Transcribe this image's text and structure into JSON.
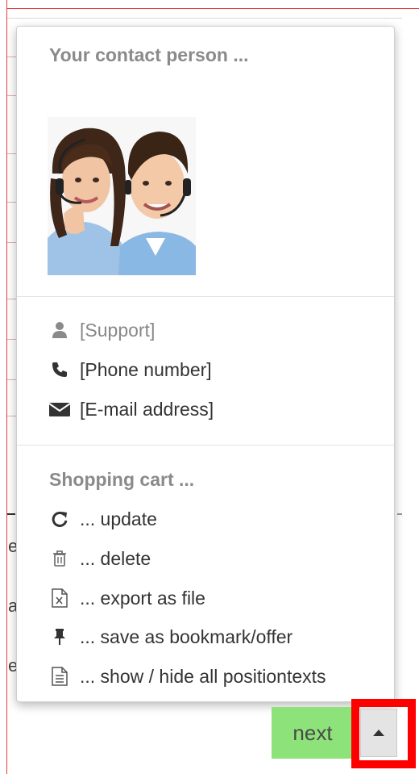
{
  "contact": {
    "title": "Your contact person ...",
    "photo_icon": "support-team-photo",
    "items": [
      {
        "icon": "user-icon",
        "label": "[Support]"
      },
      {
        "icon": "phone-icon",
        "label": "[Phone number]"
      },
      {
        "icon": "envelope-icon",
        "label": "[E-mail address]"
      }
    ]
  },
  "cart": {
    "title": "Shopping cart ...",
    "actions": [
      {
        "icon": "refresh-icon",
        "label": "... update"
      },
      {
        "icon": "trash-icon",
        "label": "... delete"
      },
      {
        "icon": "excel-file-icon",
        "label": "... export as file"
      },
      {
        "icon": "pin-icon",
        "label": "... save as bookmark/offer"
      },
      {
        "icon": "document-icon",
        "label": "... show / hide all positiontexts"
      }
    ]
  },
  "buttons": {
    "next_label": "next",
    "toggle_icon": "caret-up-icon"
  },
  "background": {
    "letters": [
      "e",
      "a",
      "e"
    ]
  },
  "colors": {
    "next_button": "#8ee27a",
    "highlight": "#ff0000",
    "section_title": "#8a8a8a"
  }
}
